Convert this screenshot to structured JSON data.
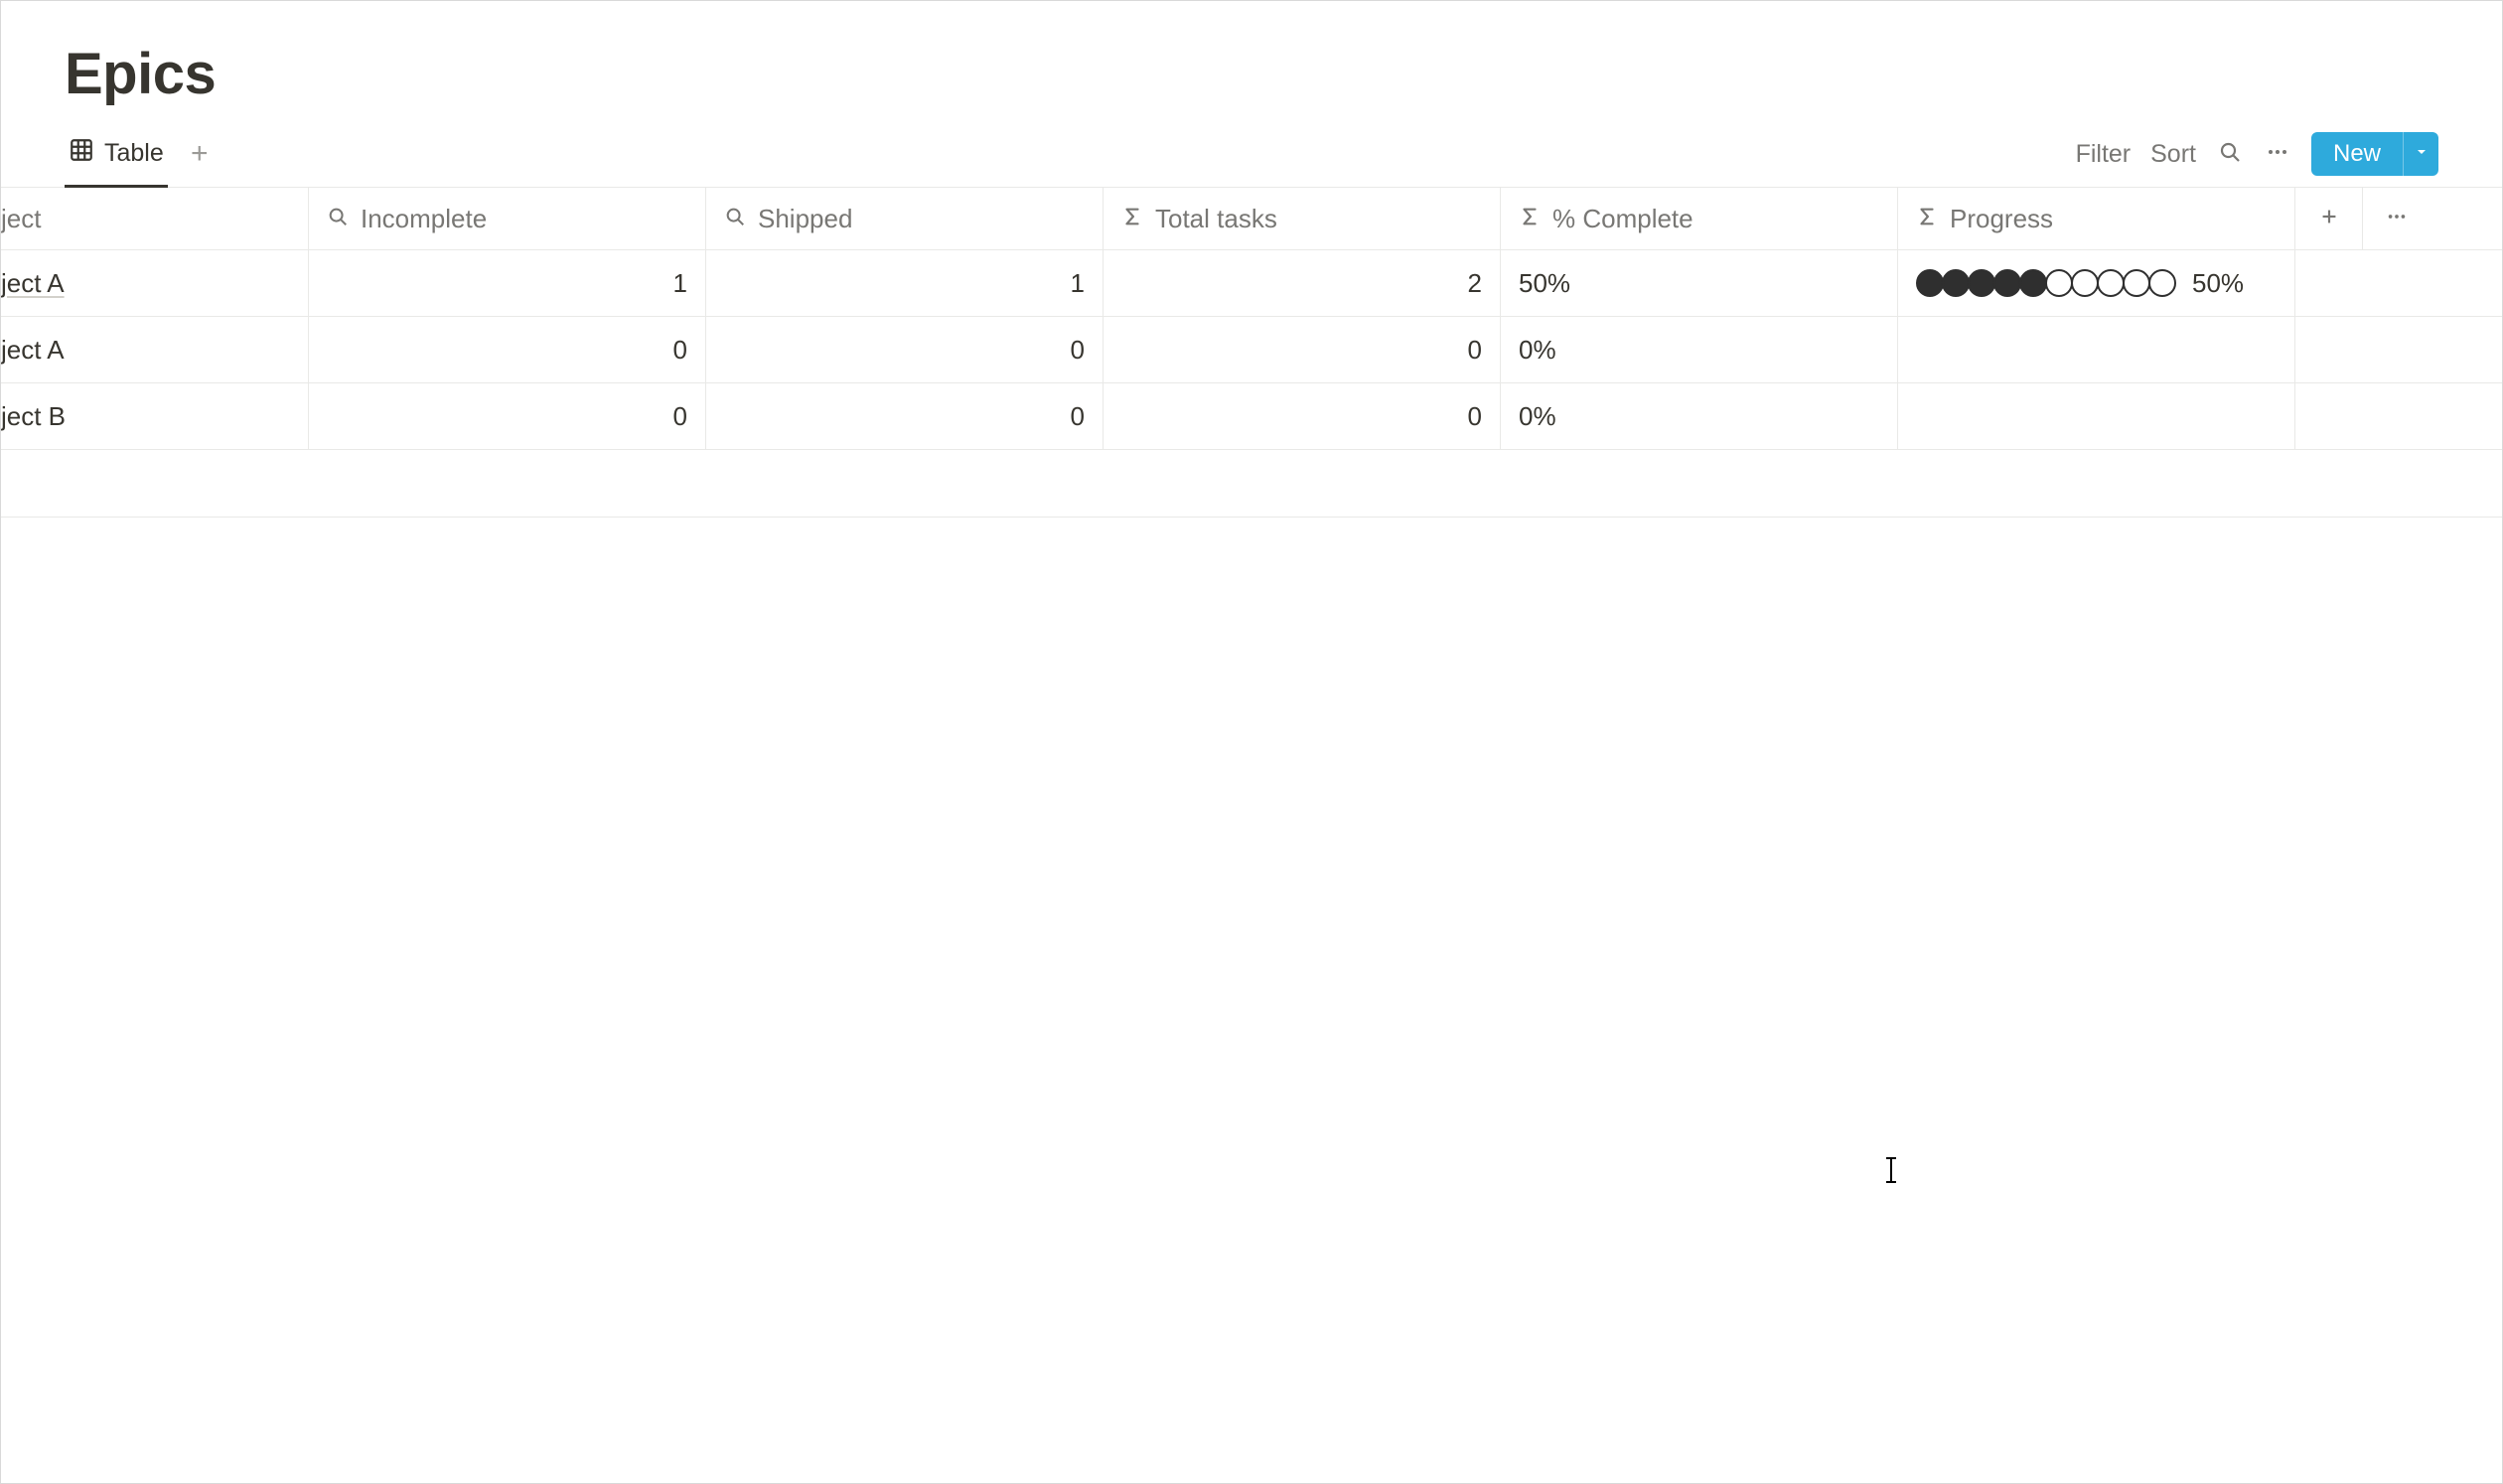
{
  "page": {
    "title": "Epics"
  },
  "toolbar": {
    "tab_label": "Table",
    "filter_label": "Filter",
    "sort_label": "Sort",
    "new_label": "New"
  },
  "columns": {
    "name": "ject",
    "incomplete": "Incomplete",
    "shipped": "Shipped",
    "total": "Total tasks",
    "pct": "% Complete",
    "progress": "Progress"
  },
  "rows": [
    {
      "name": "ject A",
      "name_linked": true,
      "incomplete": "1",
      "shipped": "1",
      "total": "2",
      "pct": "50%",
      "progress_filled": 5,
      "progress_total": 10,
      "progress_label": "50%",
      "show_progress": true
    },
    {
      "name": "ject A",
      "name_linked": false,
      "incomplete": "0",
      "shipped": "0",
      "total": "0",
      "pct": "0%",
      "progress_filled": 0,
      "progress_total": 0,
      "progress_label": "",
      "show_progress": false
    },
    {
      "name": "ject B",
      "name_linked": false,
      "incomplete": "0",
      "shipped": "0",
      "total": "0",
      "pct": "0%",
      "progress_filled": 0,
      "progress_total": 0,
      "progress_label": "",
      "show_progress": false
    }
  ]
}
